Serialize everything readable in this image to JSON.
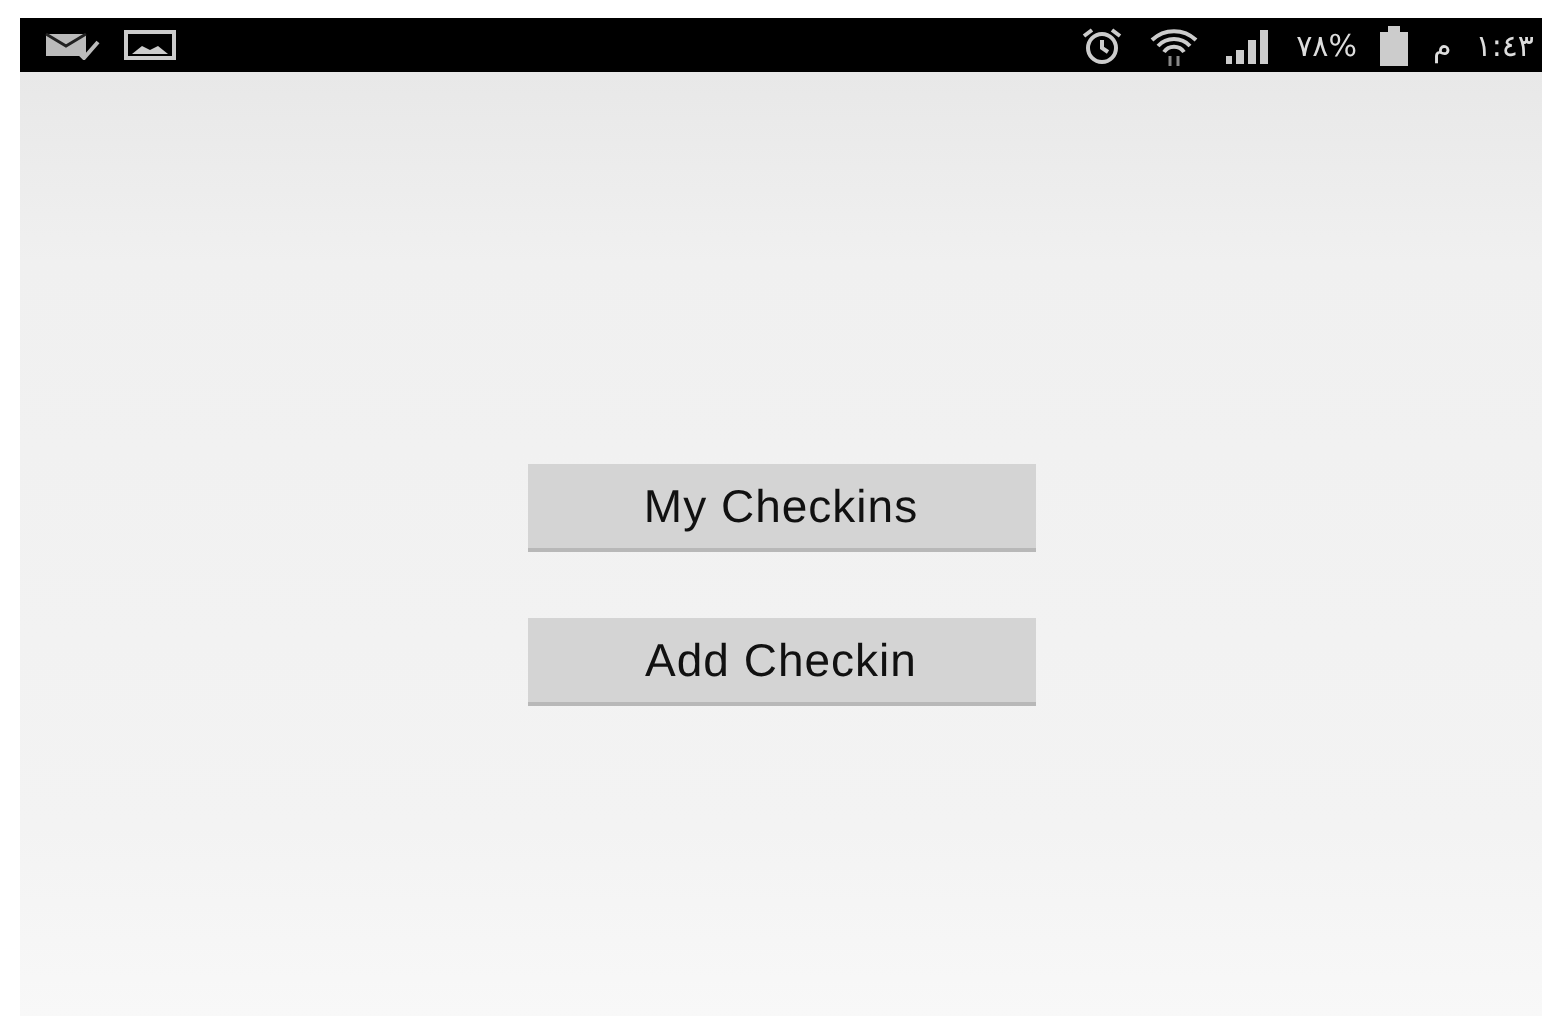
{
  "status_bar": {
    "battery_percent": "٧٨%",
    "meridiem": "م",
    "time": "١:٤٣"
  },
  "buttons": [
    {
      "label": "My Checkins"
    },
    {
      "label": "Add Checkin"
    }
  ]
}
